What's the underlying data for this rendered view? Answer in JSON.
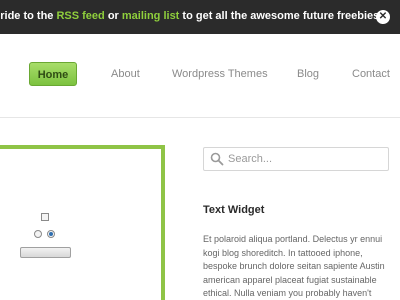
{
  "promo": {
    "text_before": "scride to the ",
    "rss_link": "RSS feed",
    "text_middle": " or ",
    "mailing_link": "mailing list",
    "text_after": " to get all the awesome future freebies!",
    "close_icon": "close-icon",
    "close_glyph": "✕"
  },
  "nav": {
    "items": [
      {
        "label": "Home",
        "active": true
      },
      {
        "label": "About"
      },
      {
        "label": "Wordpress Themes"
      },
      {
        "label": "Blog"
      },
      {
        "label": "Contact"
      }
    ]
  },
  "search": {
    "placeholder": "Search...",
    "value": "",
    "icon": "search-icon"
  },
  "form": {
    "checkbox_checked": false,
    "radios": [
      {
        "checked": false
      },
      {
        "checked": true
      }
    ]
  },
  "widget": {
    "title": "Text Widget",
    "lines": [
      "Et polaroid aliqua portland. Delectus yr ennui",
      "kogi blog shoreditch. In tattooed iphone,",
      "bespoke brunch dolore seitan sapiente Austin",
      "american apparel placeat fugiat sustainable",
      "ethical. Nulla veniam you probably haven't"
    ]
  },
  "colors": {
    "accent_green": "#8fc446",
    "link_green": "#8fcf3c",
    "bar_dark": "#2b2b2b"
  }
}
